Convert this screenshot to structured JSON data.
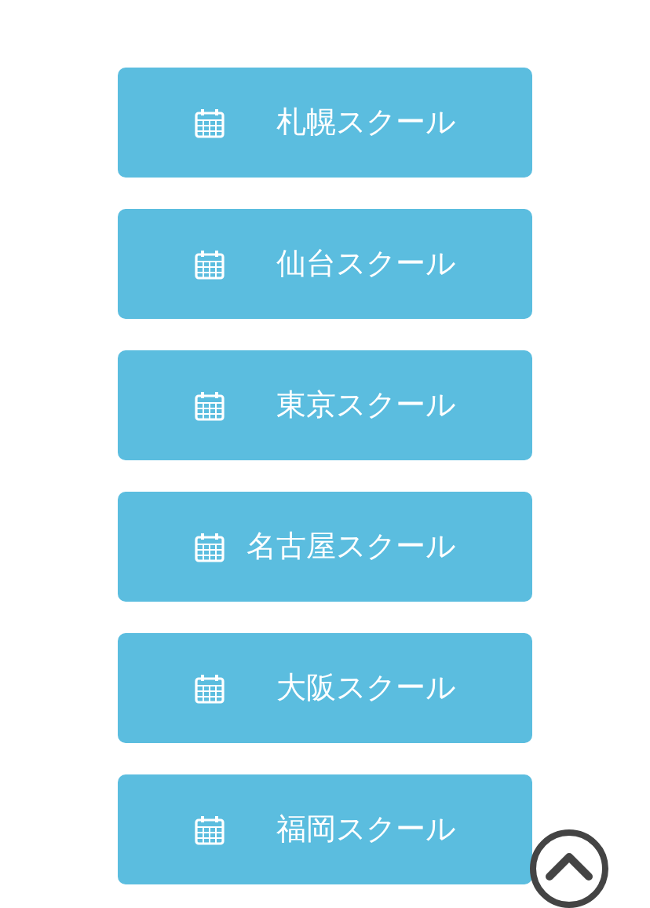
{
  "school_buttons": [
    {
      "label": "札幌スクール"
    },
    {
      "label": "仙台スクール"
    },
    {
      "label": "東京スクール"
    },
    {
      "label": "名古屋スクール"
    },
    {
      "label": "大阪スクール"
    },
    {
      "label": "福岡スクール"
    }
  ]
}
